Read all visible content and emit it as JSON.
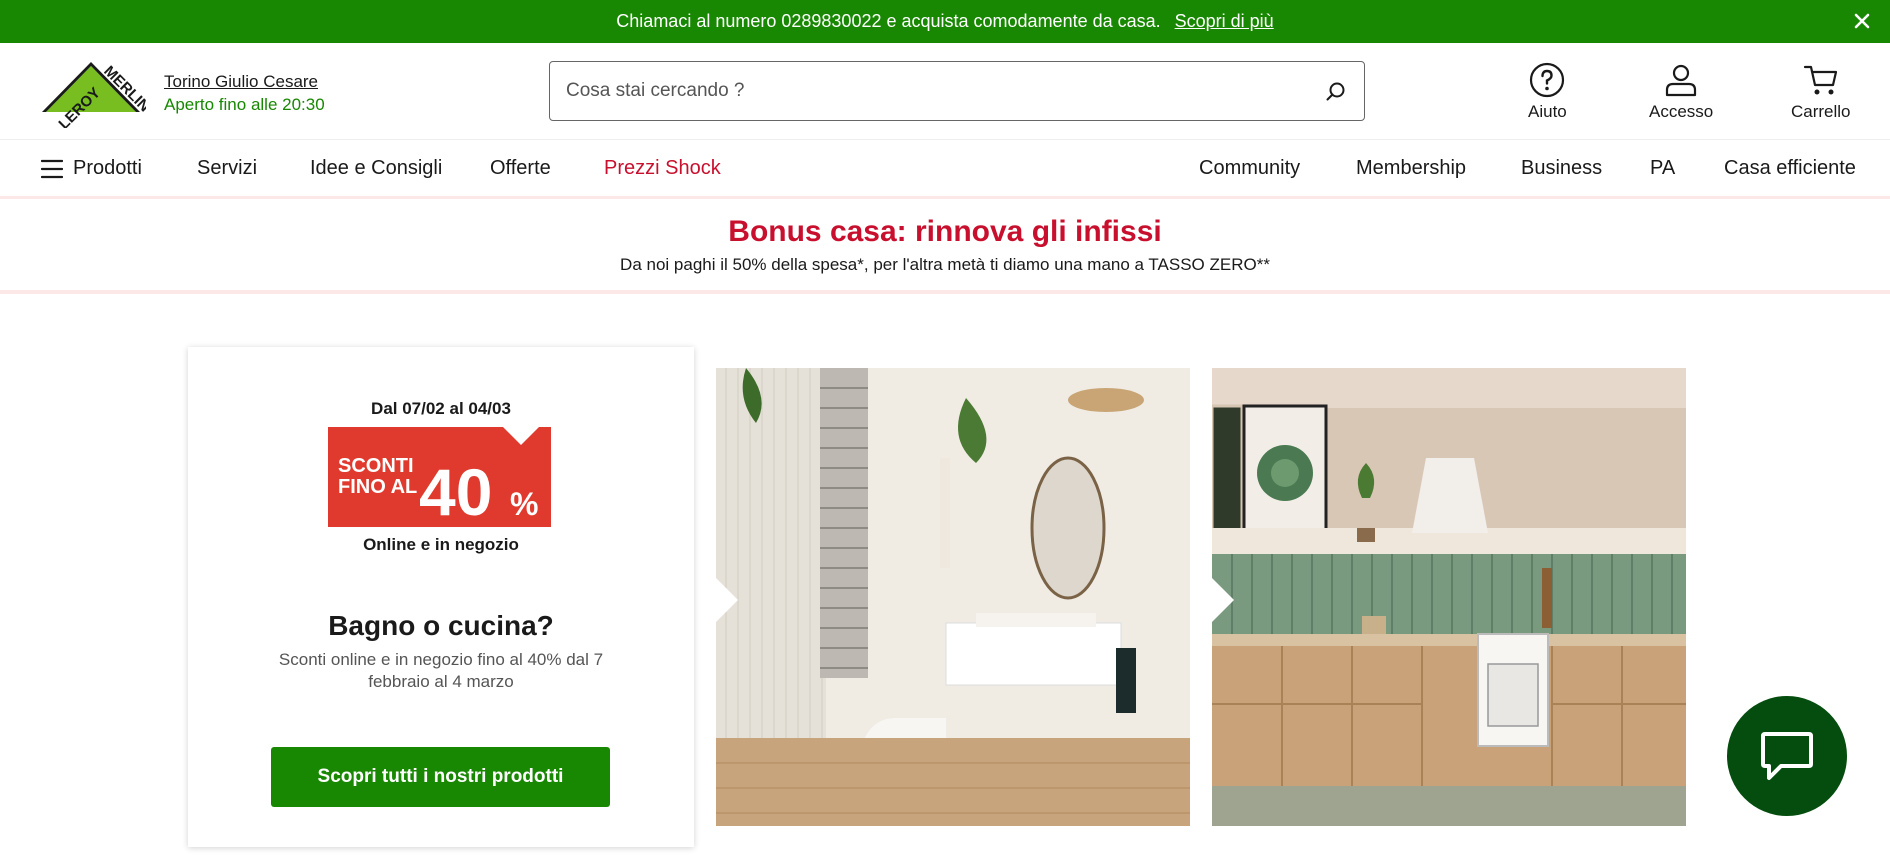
{
  "topbar": {
    "message": "Chiamaci al numero 0289830022 e acquista comodamente da casa.",
    "link": "Scopri di più",
    "close_icon": "close-icon"
  },
  "header": {
    "store_name": "Torino Giulio Cesare",
    "store_hours": "Aperto fino alle 20:30",
    "search_placeholder": "Cosa stai cercando ?",
    "help_label": "Aiuto",
    "account_label": "Accesso",
    "cart_label": "Carrello"
  },
  "nav": {
    "products": "Prodotti",
    "services": "Servizi",
    "ideas": "Idee e Consigli",
    "offers": "Offerte",
    "shock": "Prezzi Shock",
    "community": "Community",
    "membership": "Membership",
    "business": "Business",
    "pa": "PA",
    "efficient": "Casa efficiente"
  },
  "promo": {
    "title": "Bonus casa: rinnova gli infissi",
    "subtitle": "Da noi paghi il 50% della spesa*, per l'altra metà ti diamo una mano a TASSO ZERO**"
  },
  "card": {
    "date_range": "Dal 07/02 al 04/03",
    "badge_line1": "SCONTI",
    "badge_line2": "FINO AL",
    "badge_value": "40",
    "badge_percent": "%",
    "badge_footer": "Online e in negozio",
    "title": "Bagno o cucina?",
    "text": "Sconti online e in negozio fino al 40% dal 7 febbraio al 4 marzo",
    "cta": "Scopri tutti i nostri prodotti"
  },
  "colors": {
    "brand_green": "#188803",
    "promo_red": "#c8102e",
    "chat_green": "#044d0e"
  }
}
